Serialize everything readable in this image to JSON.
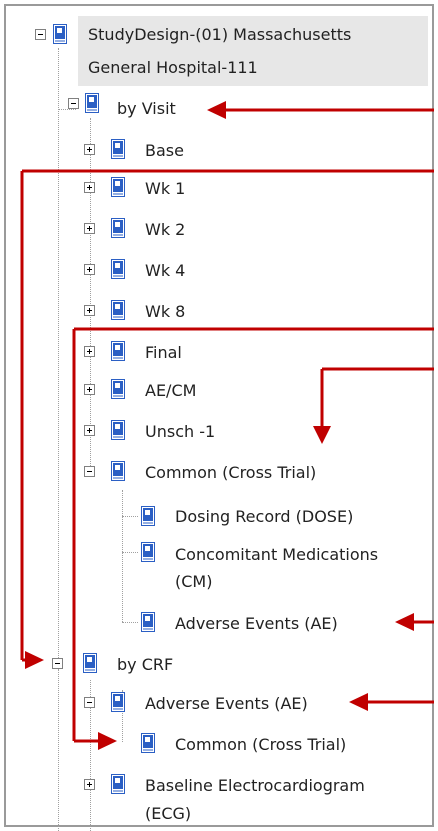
{
  "tree": {
    "root": {
      "label_line1": "StudyDesign-(01) Massachusetts",
      "label_line2": "General Hospital-111",
      "expanded": true,
      "icon": "study-book-icon"
    },
    "by_visit": {
      "label": "by Visit",
      "expanded": true,
      "icon": "book-icon",
      "children": [
        {
          "label": "Base",
          "expanded": false
        },
        {
          "label": "Wk 1",
          "expanded": false
        },
        {
          "label": "Wk 2",
          "expanded": false
        },
        {
          "label": "Wk 4",
          "expanded": false
        },
        {
          "label": "Wk 8",
          "expanded": false
        },
        {
          "label": "Final",
          "expanded": false
        },
        {
          "label": "AE/CM",
          "expanded": false
        },
        {
          "label": "Unsch -1",
          "expanded": false
        }
      ],
      "common": {
        "label": "Common (Cross Trial)",
        "expanded": true,
        "children": [
          {
            "label": "Dosing Record (DOSE)"
          },
          {
            "label_line1": "Concomitant Medications",
            "label_line2": "(CM)"
          },
          {
            "label": "Adverse Events (AE)"
          }
        ]
      }
    },
    "by_crf": {
      "label": "by CRF",
      "expanded": true,
      "icon": "book-icon",
      "adverse_events": {
        "label": "Adverse Events (AE)",
        "expanded": true,
        "children": [
          {
            "label": "Common (Cross Trial)"
          }
        ]
      },
      "baseline_ecg": {
        "label_line1": "Baseline Electrocardiogram",
        "label_line2": "(ECG)",
        "expanded": false
      }
    }
  },
  "colors": {
    "arrow": "#c00000",
    "selection": "#e7e7e7",
    "book_blue": "#2b5fc4",
    "frame": "#9a9a9a"
  }
}
